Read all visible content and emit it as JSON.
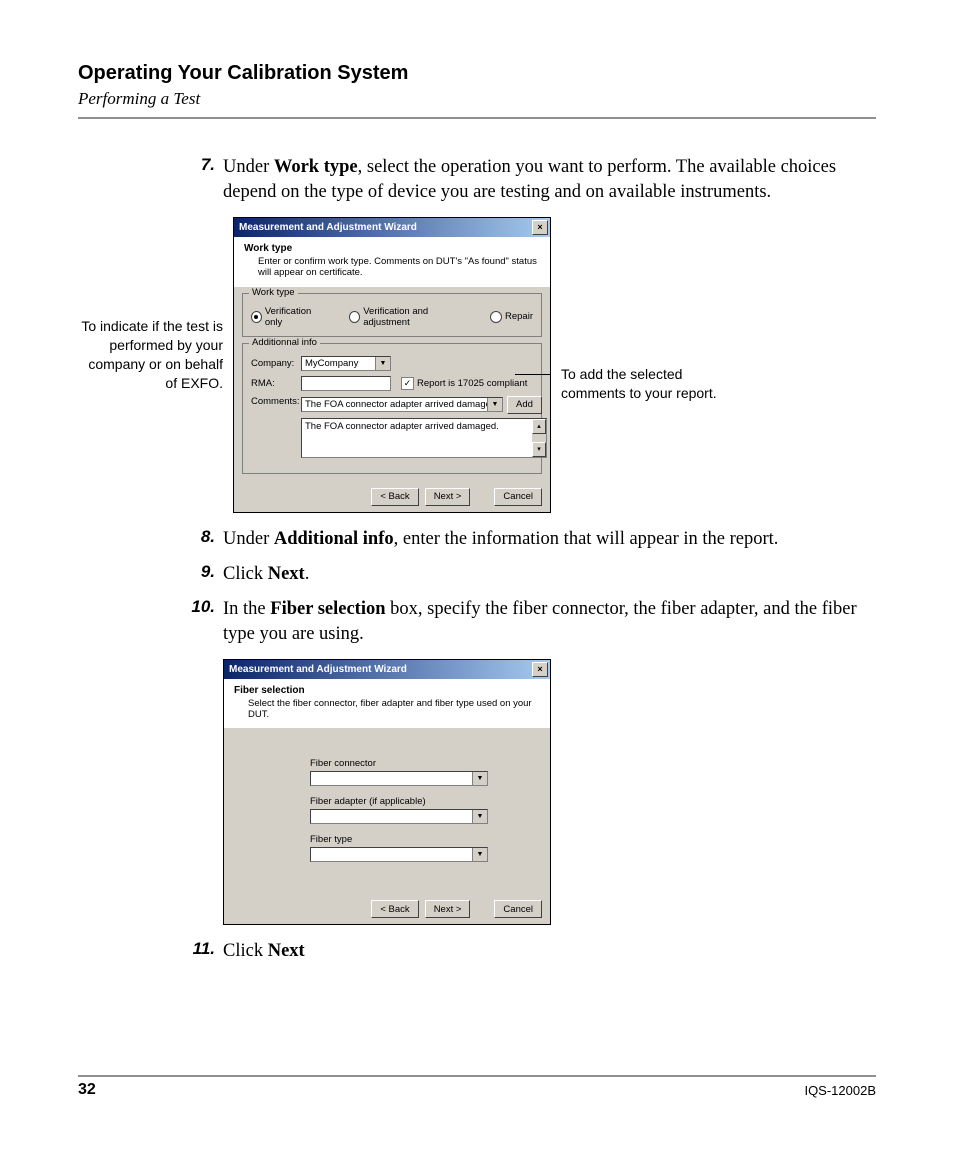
{
  "header": {
    "chapter": "Operating Your Calibration System",
    "section": "Performing a Test"
  },
  "steps": {
    "s7": {
      "num": "7.",
      "pre": "Under ",
      "bold": "Work type",
      "post": ", select the operation you want to perform. The available choices depend on the type of device you are testing and on available instruments."
    },
    "s8": {
      "num": "8.",
      "pre": "Under ",
      "bold": "Additional info",
      "post": ", enter the information that will appear in the report."
    },
    "s9": {
      "num": "9.",
      "pre": "Click ",
      "bold": "Next",
      "post": "."
    },
    "s10": {
      "num": "10.",
      "pre": "In the ",
      "bold": "Fiber selection",
      "post": " box, specify the fiber connector, the fiber adapter, and the fiber type you are using."
    },
    "s11": {
      "num": "11.",
      "pre": "Click ",
      "bold": "Next",
      "post": ""
    }
  },
  "callouts": {
    "left": "To indicate if the test is performed by your company or on behalf of EXFO.",
    "right": "To add the selected comments to your report."
  },
  "dialog1": {
    "title": "Measurement and Adjustment Wizard",
    "head_title": "Work type",
    "head_desc": "Enter or confirm work type.  Comments on DUT's \"As found\" status will appear on certificate.",
    "group_worktype": "Work type",
    "radio_verif": "Verification only",
    "radio_verif_adj": "Verification and adjustment",
    "radio_repair": "Repair",
    "group_addinfo": "Additionnal info",
    "lbl_company": "Company:",
    "val_company": "MyCompany",
    "lbl_rma": "RMA:",
    "chk_compliant": "Report is 17025 compliant",
    "lbl_comments": "Comments:",
    "val_comment_combo": "The FOA connector adapter arrived damaged.",
    "val_comment_text": "The FOA connector adapter arrived damaged.",
    "btn_add": "Add",
    "btn_back": "< Back",
    "btn_next": "Next >",
    "btn_cancel": "Cancel"
  },
  "dialog2": {
    "title": "Measurement and Adjustment Wizard",
    "head_title": "Fiber selection",
    "head_desc": "Select the fiber connector, fiber adapter and fiber type used on your DUT.",
    "lbl_connector": "Fiber connector",
    "lbl_adapter": "Fiber adapter (if applicable)",
    "lbl_type": "Fiber type",
    "btn_back": "< Back",
    "btn_next": "Next >",
    "btn_cancel": "Cancel"
  },
  "footer": {
    "page": "32",
    "doc": "IQS-12002B"
  }
}
